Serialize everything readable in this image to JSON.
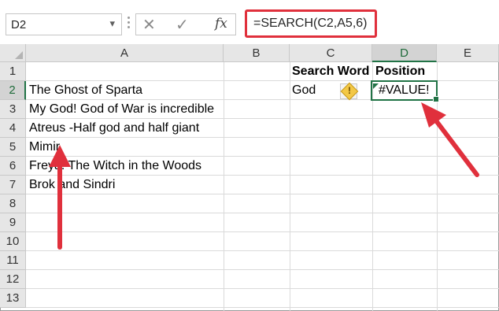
{
  "name_box": {
    "value": "D2"
  },
  "formula_bar": {
    "formula": "=SEARCH(C2,A5,6)",
    "fx_label": "fx"
  },
  "columns": [
    "A",
    "B",
    "C",
    "D",
    "E"
  ],
  "rows": [
    "1",
    "2",
    "3",
    "4",
    "5",
    "6",
    "7",
    "8",
    "9",
    "10",
    "11",
    "12",
    "13"
  ],
  "cells": {
    "C1": "Search Word",
    "D1": "Position",
    "A2": "The Ghost of Sparta",
    "C2": "God",
    "D2": "#VALUE!",
    "A3": "My God! God of War is incredible",
    "A4": "Atreus -Half god and half giant",
    "A5": "Mimir",
    "A6": "Freya: The Witch in the Woods",
    "A7": "Brok and Sindri"
  },
  "icons": {
    "cancel": "close-icon",
    "enter": "checkmark-icon",
    "function": "fx-icon",
    "error_warning": "warning-icon",
    "annotation": "red-arrow"
  },
  "colors": {
    "highlight": "#e0303c",
    "selection": "#217346",
    "warning": "#f3c846"
  }
}
